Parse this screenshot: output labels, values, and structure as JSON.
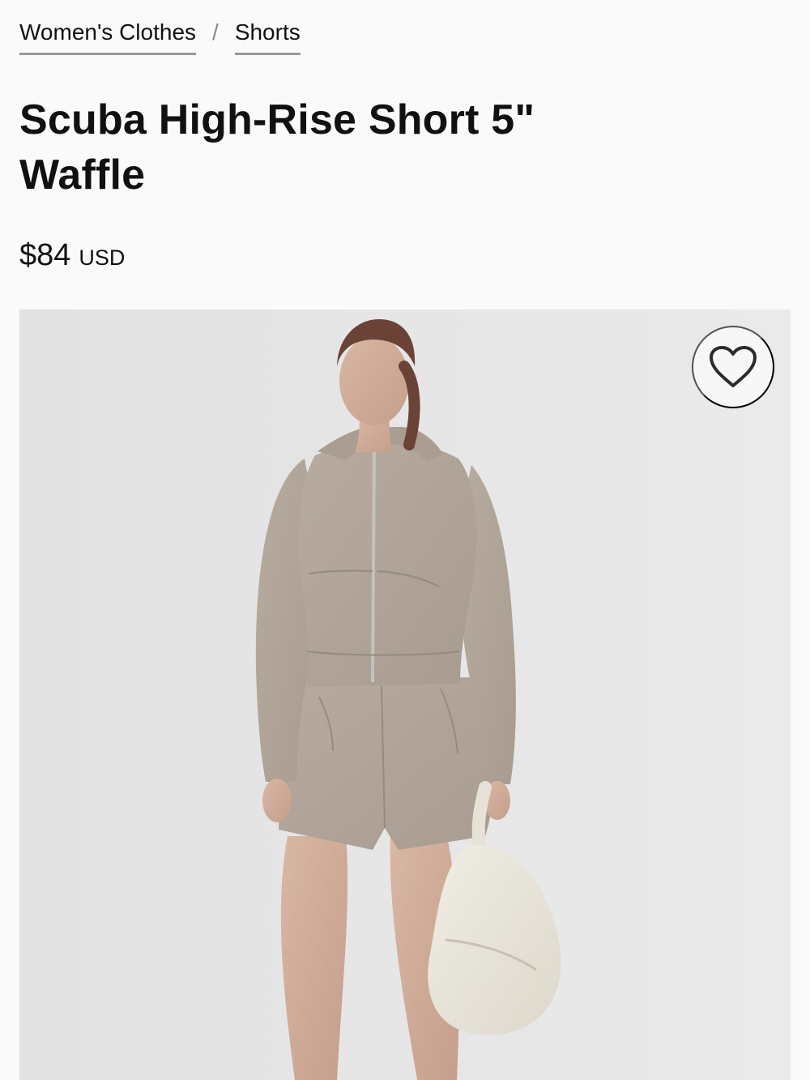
{
  "breadcrumb": {
    "items": [
      {
        "label": "Women's Clothes"
      },
      {
        "label": "Shorts"
      }
    ],
    "separator": "/"
  },
  "product": {
    "title": "Scuba High-Rise Short 5\" Waffle",
    "price": "$84",
    "currency": "USD",
    "image_alt_meaning": "model wearing taupe waffle zip hoodie and matching shorts, carrying cream bag"
  },
  "wishlist": {
    "icon": "heart-outline-icon"
  },
  "colors": {
    "page_bg": "#fafafa",
    "image_bg": "#e7e7e8",
    "text": "#111111",
    "underline": "#999999",
    "garment_taupe": "#b4a79b",
    "bag_cream": "#ece8dc"
  }
}
